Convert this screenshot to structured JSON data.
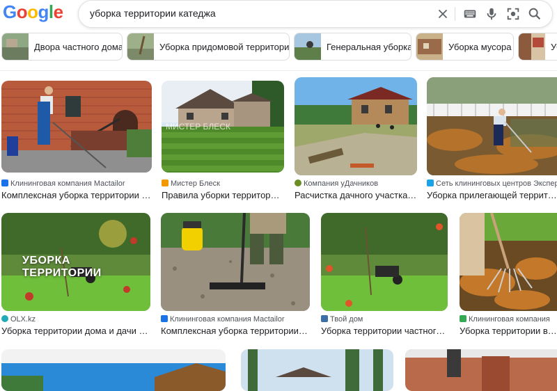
{
  "logo": "Google",
  "search": {
    "query": "уборка территории катеджа"
  },
  "search_icons": [
    "clear-icon",
    "keyboard-icon",
    "microphone-icon",
    "lens-icon",
    "search-icon"
  ],
  "chips": [
    {
      "label": "Двора частного дома",
      "color": "#6b7d5e"
    },
    {
      "label": "Уборка придомовой территории",
      "color": "#7c8a6a"
    },
    {
      "label": "Генеральная уборка",
      "color": "#5e7f4a"
    },
    {
      "label": "Уборка мусора",
      "color": "#9a6b4b"
    },
    {
      "label": "Уб",
      "color": "#8c5a3c"
    }
  ],
  "results": [
    {
      "source": "Клининговая компания Mactailor",
      "title": "Комплексная уборка территории дом...",
      "fav_color": "#1a73e8"
    },
    {
      "source": "Мистер Блеск",
      "title": "Правила уборки территории ...",
      "fav_color": "#f29900",
      "watermark": "МИСТЕР БЛЕСК"
    },
    {
      "source": "Компания уДачников",
      "title": "Расчистка дачного участка от...",
      "fav_color": "#6b8e23"
    },
    {
      "source": "Сеть клининговых центров Эксперт ...",
      "title": "Уборка прилегающей территории",
      "fav_color": "#1aa3e8"
    },
    {
      "source": "OLX.kz",
      "title": "Уборка территории дома и дачи - Уб...",
      "fav_color": "#23a9b7",
      "overlay": "УБОРКА ТЕРРИТОРИИ"
    },
    {
      "source": "Клининговая компания Mactailor",
      "title": "Комплексная уборка территории до...",
      "fav_color": "#1a73e8"
    },
    {
      "source": "Твой дом",
      "title": "Уборка территории частного д...",
      "fav_color": "#3c6ea8"
    },
    {
      "source": "Клининговая компания",
      "title": "Уборка территории в Мо...",
      "fav_color": "#34a853"
    }
  ]
}
